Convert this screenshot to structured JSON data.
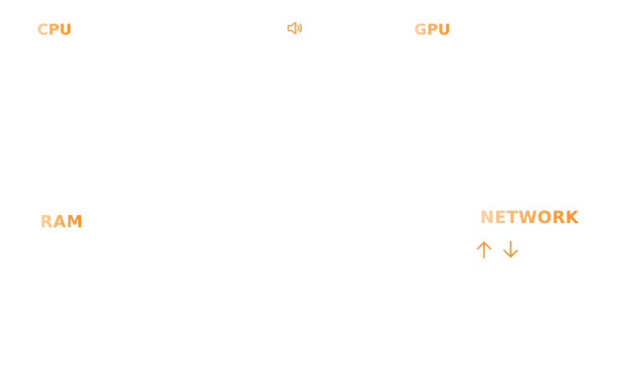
{
  "panels": {
    "cpu": {
      "title": "CPU"
    },
    "gpu": {
      "title": "GPU"
    },
    "ram": {
      "title": "RAM"
    },
    "network": {
      "title": "NETWORK"
    }
  },
  "icons": {
    "volume": "speaker-volume-icon",
    "upload": "arrow-up-icon",
    "download": "arrow-down-icon"
  },
  "colors": {
    "accent": "#ff8c1a",
    "accent_light": "#ffd0a3",
    "background": "#ffffff"
  }
}
